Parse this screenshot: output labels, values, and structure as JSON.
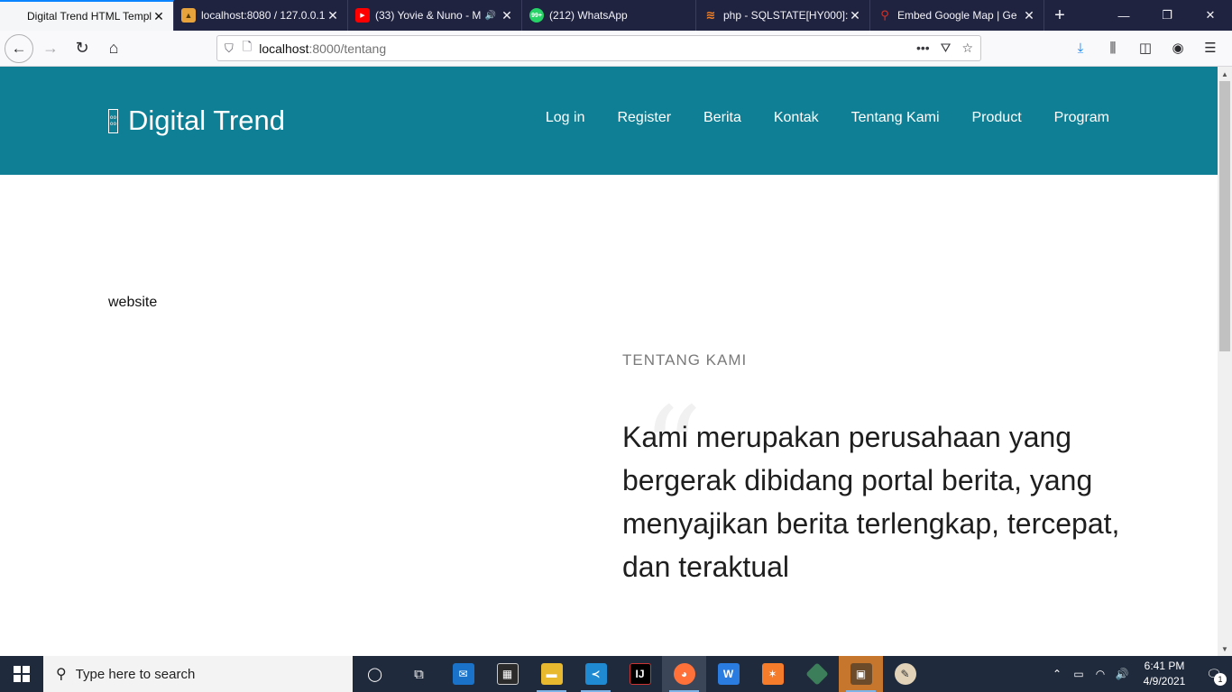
{
  "browser": {
    "tabs": [
      {
        "title": "Digital Trend HTML Template",
        "icon": "page-icon",
        "active": true
      },
      {
        "title": "localhost:8080 / 127.0.0.1",
        "icon": "phpmyadmin-icon",
        "active": false
      },
      {
        "title": "(33) Yovie & Nuno - M",
        "icon": "youtube-icon",
        "active": false,
        "audio": true
      },
      {
        "title": "(212) WhatsApp",
        "icon": "whatsapp-icon",
        "active": false
      },
      {
        "title": "php - SQLSTATE[HY000]:",
        "icon": "stackoverflow-icon",
        "active": false
      },
      {
        "title": "Embed Google Map | Ge",
        "icon": "maps-icon",
        "active": false
      }
    ],
    "url_host": "localhost",
    "url_path": ":8000/tentang",
    "whatsapp_badge": "99+"
  },
  "site": {
    "brand": "Digital Trend",
    "logo_glyph_top": "oo",
    "logo_glyph_bottom": "oo",
    "nav": [
      "Log in",
      "Register",
      "Berita",
      "Kontak",
      "Tentang Kami",
      "Product",
      "Program"
    ],
    "header_color": "#0e7f94"
  },
  "content": {
    "website_text": "website",
    "section_label": "TENTANG KAMI",
    "quote_mark": "“",
    "lead": "Kami merupakan perusahaan yang bergerak dibidang portal berita, yang menyajikan berita terlengkap, tercepat, dan teraktual"
  },
  "taskbar": {
    "search_placeholder": "Type here to search",
    "time": "6:41 PM",
    "date": "4/9/2021",
    "notification_count": "1"
  }
}
